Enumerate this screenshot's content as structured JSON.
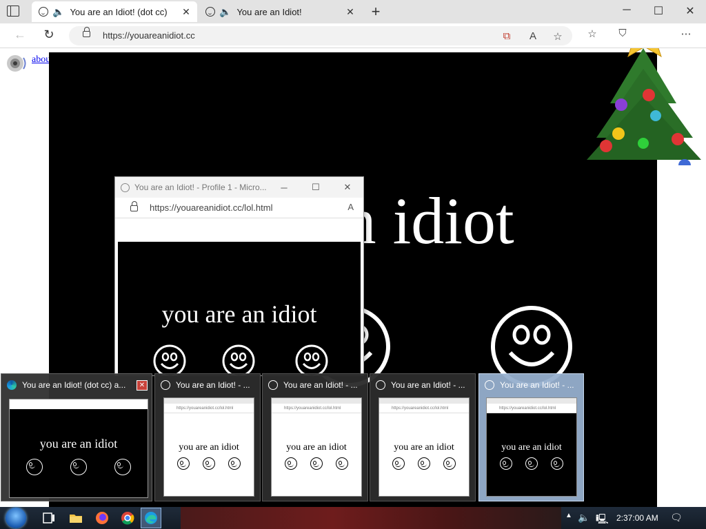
{
  "browser": {
    "tabs": [
      {
        "title": "You are an Idiot! (dot cc)",
        "active": true
      },
      {
        "title": "You are an Idiot!",
        "active": false
      }
    ],
    "url": "https://youareanidiot.cc"
  },
  "page": {
    "about_link": "about flash",
    "headline": "an idiot"
  },
  "popup": {
    "title": "You are an Idiot! - Profile 1 - Micro...",
    "url": "https://youareanidiot.cc/lol.html",
    "message": "you are an idiot"
  },
  "thumbnails": [
    {
      "title": "You are an Idiot! (dot cc) a...",
      "message": "you are an idiot",
      "icon": "edge-icon"
    },
    {
      "title": "You are an Idiot! - ...",
      "message": "you are an idiot",
      "icon": "smiley-icon"
    },
    {
      "title": "You are an Idiot! - ...",
      "message": "you are an idiot",
      "icon": "smiley-icon"
    },
    {
      "title": "You are an Idiot! - ...",
      "message": "you are an idiot",
      "icon": "smiley-icon"
    },
    {
      "title": "You are an Idiot! - ...",
      "message": "you are an idiot",
      "icon": "smiley-icon"
    }
  ],
  "taskbar": {
    "time": "2:37:00 AM"
  },
  "colors": {
    "link": "#0000ee",
    "page_black": "#000000",
    "thumb_active": "#96afcd",
    "close_red": "#c8423a"
  }
}
